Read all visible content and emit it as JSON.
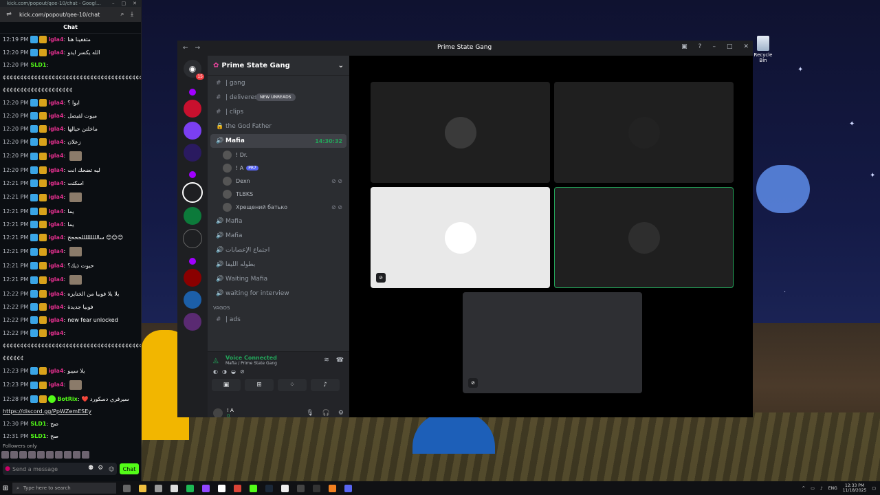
{
  "browser": {
    "title": "kick.com/popout/qee-10/chat - Googl...",
    "url": "kick.com/popout/qee-10/chat"
  },
  "chat": {
    "header": "Chat",
    "messages": [
      {
        "time": "12:19 PM",
        "user": "igla4",
        "text": "مثقفينا هنا",
        "color": "#e02e8c",
        "emote": false
      },
      {
        "time": "12:20 PM",
        "user": "igla4",
        "text": "الله يكسر ايدو",
        "color": "#e02e8c",
        "emote": false
      },
      {
        "time": "12:20 PM",
        "user": "SLD1",
        "text": "",
        "color": "#53fc18",
        "emote": false
      },
      {
        "time": "",
        "user": "",
        "text": "¢¢¢¢¢¢¢¢¢¢¢¢¢¢¢¢¢¢¢¢¢¢¢¢¢¢¢¢¢¢¢¢¢¢¢¢¢¢¢¢¢¢¢¢¢¢",
        "color": "#fff",
        "emote": false
      },
      {
        "time": "",
        "user": "",
        "text": "¢¢¢¢¢¢¢¢¢¢¢¢¢¢¢¢¢¢¢¢",
        "color": "#fff",
        "emote": false
      },
      {
        "time": "12:20 PM",
        "user": "igla4",
        "text": "ابوا ؟",
        "color": "#e02e8c",
        "emote": false
      },
      {
        "time": "12:20 PM",
        "user": "igla4",
        "text": "ميوت لفيصل",
        "color": "#e02e8c",
        "emote": false
      },
      {
        "time": "12:20 PM",
        "user": "igla4",
        "text": "ماخلتن حيالها",
        "color": "#e02e8c",
        "emote": false
      },
      {
        "time": "12:20 PM",
        "user": "igla4",
        "text": "زعلان",
        "color": "#e02e8c",
        "emote": false
      },
      {
        "time": "12:20 PM",
        "user": "igla4",
        "text": "",
        "color": "#e02e8c",
        "emote": true
      },
      {
        "time": "12:20 PM",
        "user": "igla4",
        "text": "ليه تضحك انت",
        "color": "#e02e8c",
        "emote": false
      },
      {
        "time": "12:21 PM",
        "user": "igla4",
        "text": "اسكتت",
        "color": "#e02e8c",
        "emote": false
      },
      {
        "time": "12:21 PM",
        "user": "igla4",
        "text": "",
        "color": "#e02e8c",
        "emote": true
      },
      {
        "time": "12:21 PM",
        "user": "igla4",
        "text": "يما",
        "color": "#e02e8c",
        "emote": false
      },
      {
        "time": "12:21 PM",
        "user": "igla4",
        "text": "يما",
        "color": "#e02e8c",
        "emote": false
      },
      {
        "time": "12:21 PM",
        "user": "igla4",
        "text": "سالللللللللحححح 😊😊😊",
        "color": "#e02e8c",
        "emote": false
      },
      {
        "time": "12:21 PM",
        "user": "igla4",
        "text": "",
        "color": "#e02e8c",
        "emote": true
      },
      {
        "time": "12:21 PM",
        "user": "igla4",
        "text": "حيوت ذيك؟",
        "color": "#e02e8c",
        "emote": false
      },
      {
        "time": "12:21 PM",
        "user": "igla4",
        "text": "",
        "color": "#e02e8c",
        "emote": true
      },
      {
        "time": "12:22 PM",
        "user": "igla4",
        "text": "يلا يلا فوبيا من الخنايزه",
        "color": "#e02e8c",
        "emote": false
      },
      {
        "time": "12:22 PM",
        "user": "igla4",
        "text": "فوبيا جديدة",
        "color": "#e02e8c",
        "emote": false
      },
      {
        "time": "12:22 PM",
        "user": "igla4",
        "text": "new fear unlocked",
        "color": "#e02e8c",
        "emote": false
      },
      {
        "time": "12:22 PM",
        "user": "igla4",
        "text": "",
        "color": "#e02e8c",
        "emote": false
      },
      {
        "time": "",
        "user": "",
        "text": "¢¢¢¢¢¢¢¢¢¢¢¢¢¢¢¢¢¢¢¢¢¢¢¢¢¢¢¢¢¢¢¢¢¢¢¢¢¢¢¢¢¢¢¢¢¢",
        "color": "#fff",
        "emote": false
      },
      {
        "time": "",
        "user": "",
        "text": "¢¢¢¢¢¢",
        "color": "#fff",
        "emote": false
      },
      {
        "time": "12:23 PM",
        "user": "igla4",
        "text": "يلا سيبو",
        "color": "#e02e8c",
        "emote": false
      },
      {
        "time": "12:23 PM",
        "user": "igla4",
        "text": "",
        "color": "#e02e8c",
        "emote": true
      },
      {
        "time": "12:28 PM",
        "user": "BotRix",
        "text": "❤️ سيرفري دسكورد",
        "color": "#53fc18",
        "emote": false
      },
      {
        "time": "",
        "user": "",
        "text": "https://discord.gg/PpWZemESEy",
        "color": "#fff",
        "emote": false,
        "link": true
      },
      {
        "time": "12:30 PM",
        "user": "SLD1",
        "text": "صح",
        "color": "#53fc18",
        "emote": false
      },
      {
        "time": "12:31 PM",
        "user": "SLD1",
        "text": "صح",
        "color": "#53fc18",
        "emote": false
      },
      {
        "time": "12:31 PM",
        "user": "SLD1",
        "text": "صح",
        "color": "#53fc18",
        "emote": false
      },
      {
        "time": "12:31 PM",
        "user": "SLD1",
        "text": "صح",
        "color": "#53fc18",
        "emote": false
      }
    ],
    "followers_only": "Followers only",
    "input_placeholder": "Send a message",
    "send_label": "Chat"
  },
  "discord": {
    "window_title": "Prime State Gang",
    "server_name": "Prime State Gang",
    "home_badge": "15",
    "new_unreads": "NEW UNREADS",
    "channels": [
      {
        "icon": "#",
        "name": "| gang",
        "type": "text"
      },
      {
        "icon": "#",
        "name": "| deliveres",
        "type": "text"
      },
      {
        "icon": "#",
        "name": "| clips",
        "type": "text"
      },
      {
        "icon": "🔒",
        "name": "the God Father",
        "type": "locked"
      }
    ],
    "active_channel": {
      "name": "Mafia",
      "timer": "14:30:32"
    },
    "voice_users": [
      {
        "name": "! Dr.",
        "extra": ""
      },
      {
        "name": "! A",
        "extra": "PR7"
      },
      {
        "name": "Dexn",
        "extra": ""
      },
      {
        "name": "TLBKS",
        "extra": ""
      },
      {
        "name": "Хрещений батько",
        "extra": ""
      }
    ],
    "more_channels": [
      {
        "icon": "🔊",
        "name": "Mafia"
      },
      {
        "icon": "🔊",
        "name": "Mafia"
      },
      {
        "icon": "🔊",
        "name": "اجتماع الإعصابات"
      },
      {
        "icon": "🔊",
        "name": "بطوله الليفا"
      },
      {
        "icon": "🔊",
        "name": "Waiting Mafia"
      },
      {
        "icon": "🔊",
        "name": "waiting for interview"
      }
    ],
    "category": "VAGOS",
    "category_channel": "| ads",
    "voice_connected": "Voice Connected",
    "voice_location": "Mafia / Prime State Gang",
    "user_name": "! A",
    "user_status": "0"
  },
  "desktop": {
    "recycle_bin": "Recycle Bin"
  },
  "taskbar": {
    "search_placeholder": "Type here to search",
    "lang": "ENG",
    "time": "12:33 PM",
    "date": "11/18/2025"
  }
}
